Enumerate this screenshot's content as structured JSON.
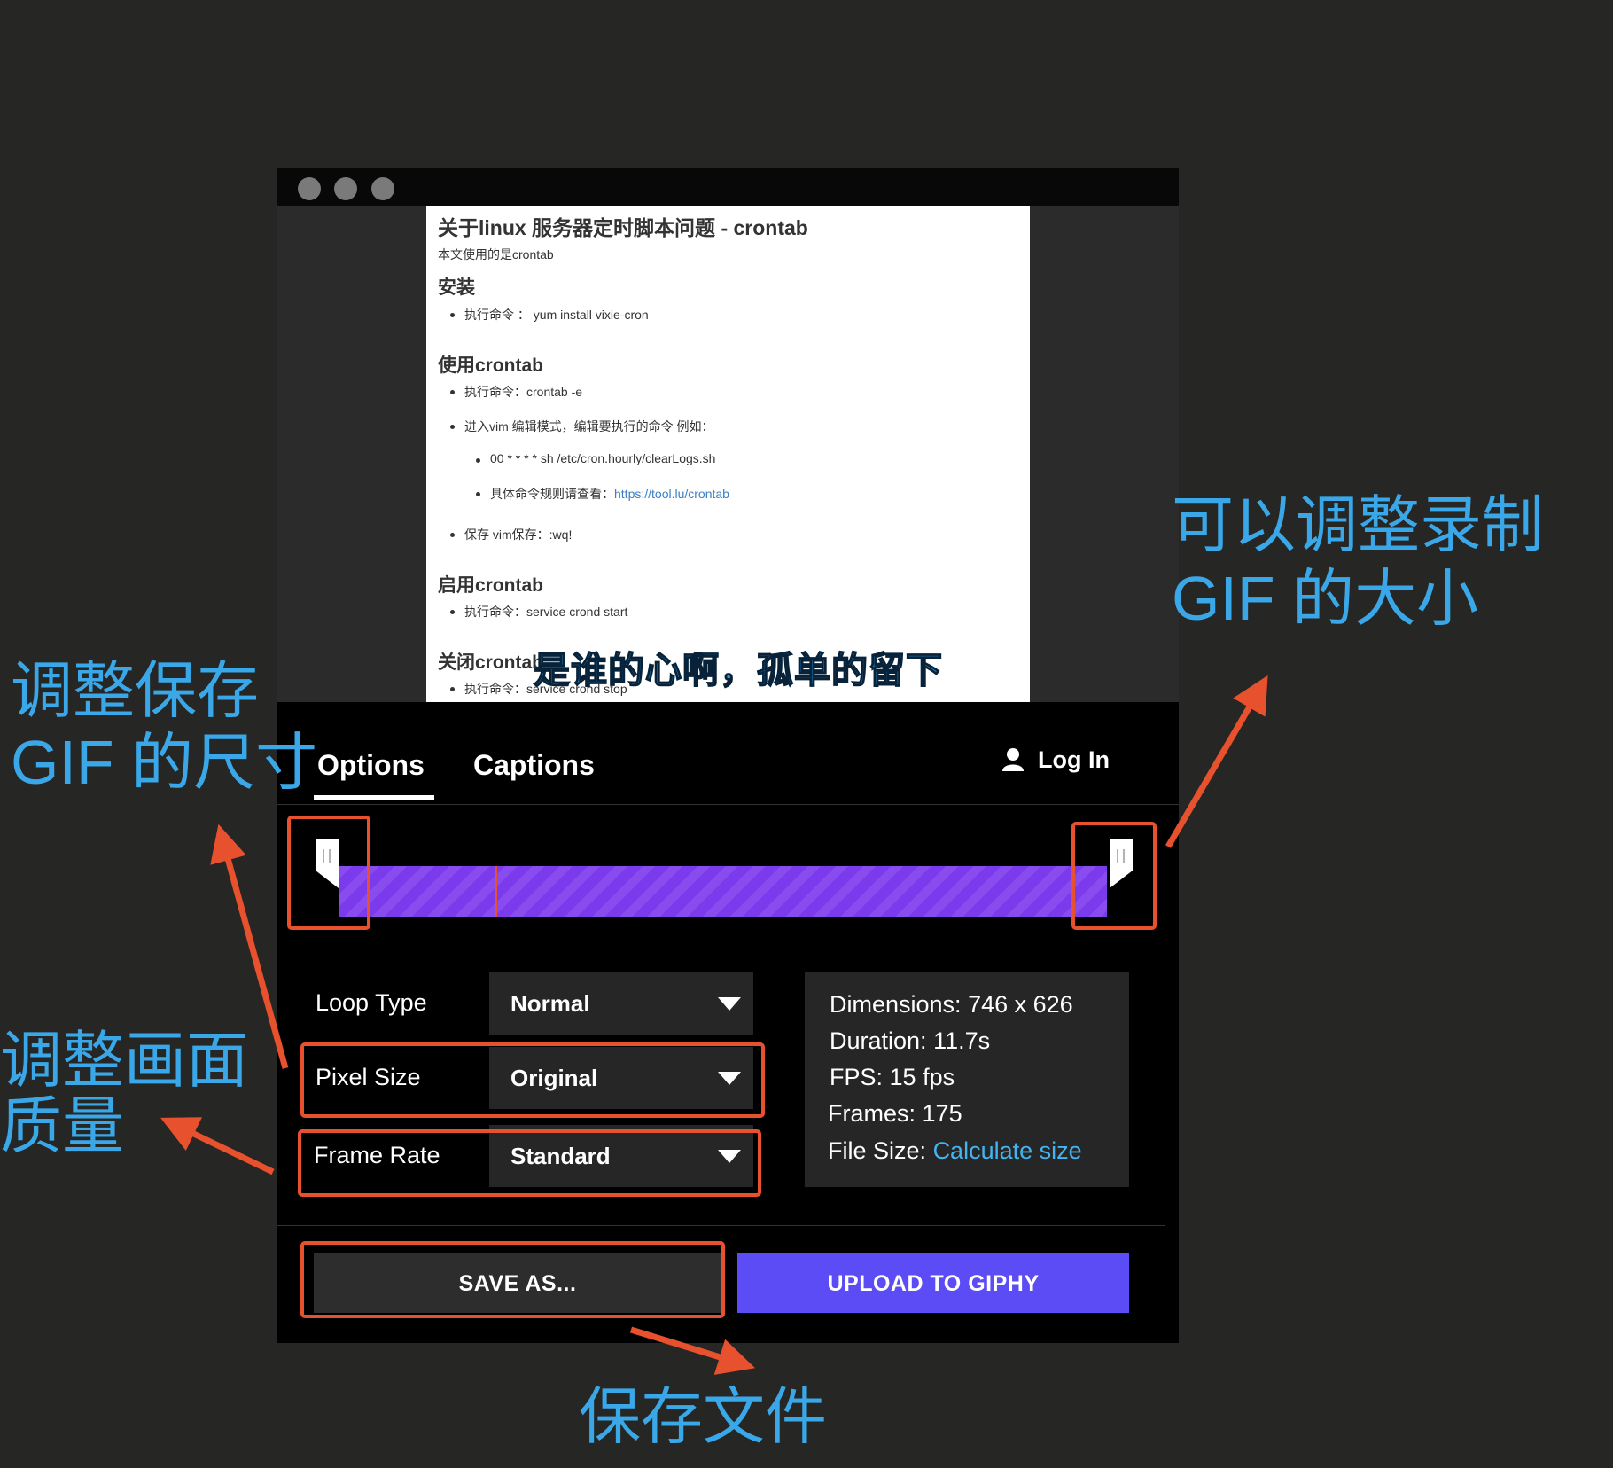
{
  "document": {
    "title": "关于linux 服务器定时脚本问题 - crontab",
    "intro": "本文使用的是crontab",
    "sections": [
      {
        "heading": "安装",
        "items": [
          "执行命令 ： yum install vixie-cron"
        ]
      },
      {
        "heading": "使用crontab",
        "items": [
          "执行命令：crontab -e",
          "进入vim 编辑模式，编辑要执行的命令 例如：",
          "00 * * * * sh /etc/cron.hourly/clearLogs.sh",
          "具体命令规则请查看：",
          "保存 vim保存：:wq!"
        ],
        "link": "https://tool.lu/crontab"
      },
      {
        "heading": "启用crontab",
        "items": [
          "执行命令：service crond start"
        ]
      },
      {
        "heading": "关闭crontab",
        "items": [
          "执行命令：service crond stop"
        ]
      }
    ]
  },
  "subtitle": "是谁的心啊，孤单的留下",
  "tabs": {
    "options": "Options",
    "captions": "Captions"
  },
  "login": "Log In",
  "options": {
    "loop_type": {
      "label": "Loop Type",
      "value": "Normal"
    },
    "pixel_size": {
      "label": "Pixel Size",
      "value": "Original"
    },
    "frame_rate": {
      "label": "Frame Rate",
      "value": "Standard"
    }
  },
  "info": {
    "dimensions_label": "Dimensions:",
    "dimensions_value": "746 x 626",
    "duration_label": "Duration:",
    "duration_value": "11.7s",
    "fps_label": "FPS:",
    "fps_value": "15 fps",
    "frames_label": "Frames:",
    "frames_value": "175",
    "filesize_label": "File Size:",
    "filesize_link": "Calculate size"
  },
  "buttons": {
    "save": "SAVE AS...",
    "upload": "UPLOAD TO GIPHY"
  },
  "annotations": {
    "adjust_size_line1": "可以调整录制",
    "adjust_size_line2": "GIF 的大小",
    "save_size_line1": "调整保存",
    "save_size_line2": "GIF 的尺寸",
    "quality_line1": "调整画面",
    "quality_line2": "质量",
    "save_file": "保存文件"
  },
  "colors": {
    "accent_track": "#7c3aed",
    "upload_button": "#5b4cf5",
    "annotation_text": "#3aa8e8",
    "annotation_box": "#e8512d"
  }
}
